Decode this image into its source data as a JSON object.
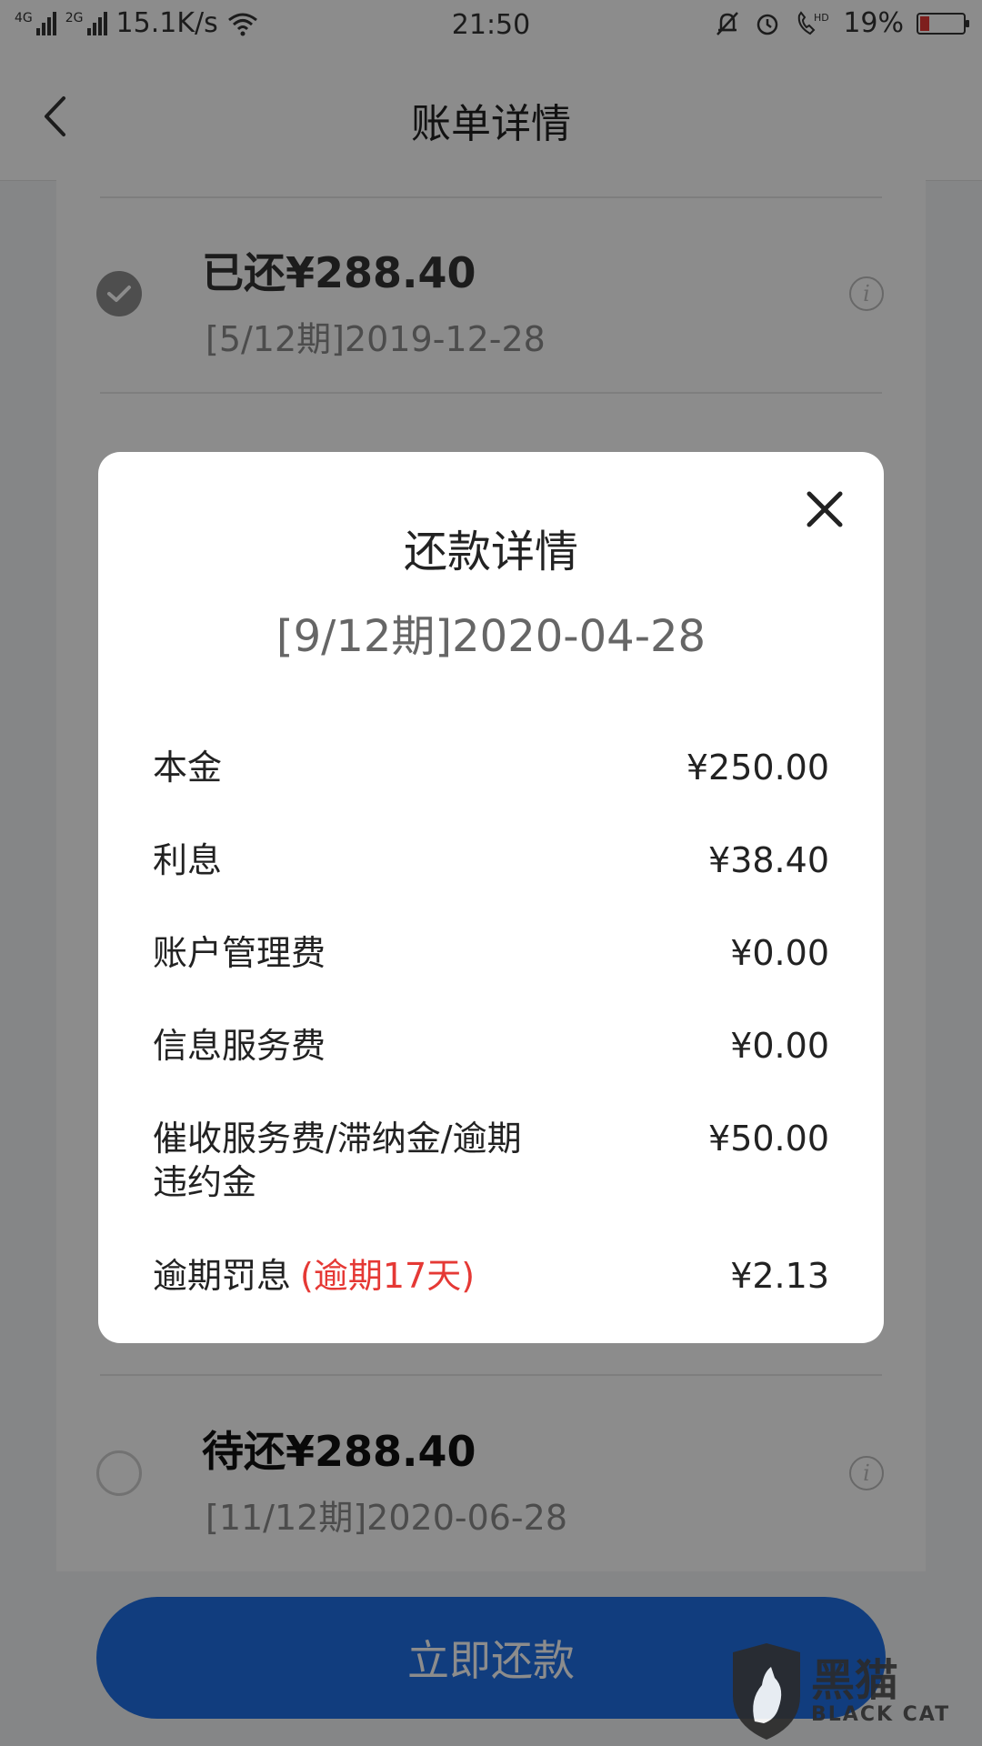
{
  "status_bar": {
    "net1": "4G",
    "net2": "2G",
    "speed": "15.1K/s",
    "time": "21:50",
    "hd": "HD",
    "battery": "19%"
  },
  "nav": {
    "title": "账单详情"
  },
  "bills": [
    {
      "title": "已还¥288.40",
      "sub": "[5/12期]2019-12-28",
      "status": "paid"
    },
    {
      "title": "待还¥288.40",
      "sub": "[11/12期]2020-06-28",
      "status": "pending"
    }
  ],
  "pay_button": "立即还款",
  "modal": {
    "title": "还款详情",
    "period": "[9/12期]2020-04-28",
    "items": [
      {
        "label": "本金",
        "value": "¥250.00"
      },
      {
        "label": "利息",
        "value": "¥38.40"
      },
      {
        "label": "账户管理费",
        "value": "¥0.00"
      },
      {
        "label": "信息服务费",
        "value": "¥0.00"
      },
      {
        "label": "催收服务费/滞纳金/逾期违约金",
        "value": "¥50.00"
      },
      {
        "label": "逾期罚息",
        "note": "(逾期17天)",
        "value": "¥2.13"
      }
    ]
  },
  "watermark": {
    "cn": "黑猫",
    "en": "BLACK CAT"
  },
  "colors": {
    "primary": "#1f6fe5",
    "overdue": "#e53935",
    "battery_low": "#e53935"
  }
}
